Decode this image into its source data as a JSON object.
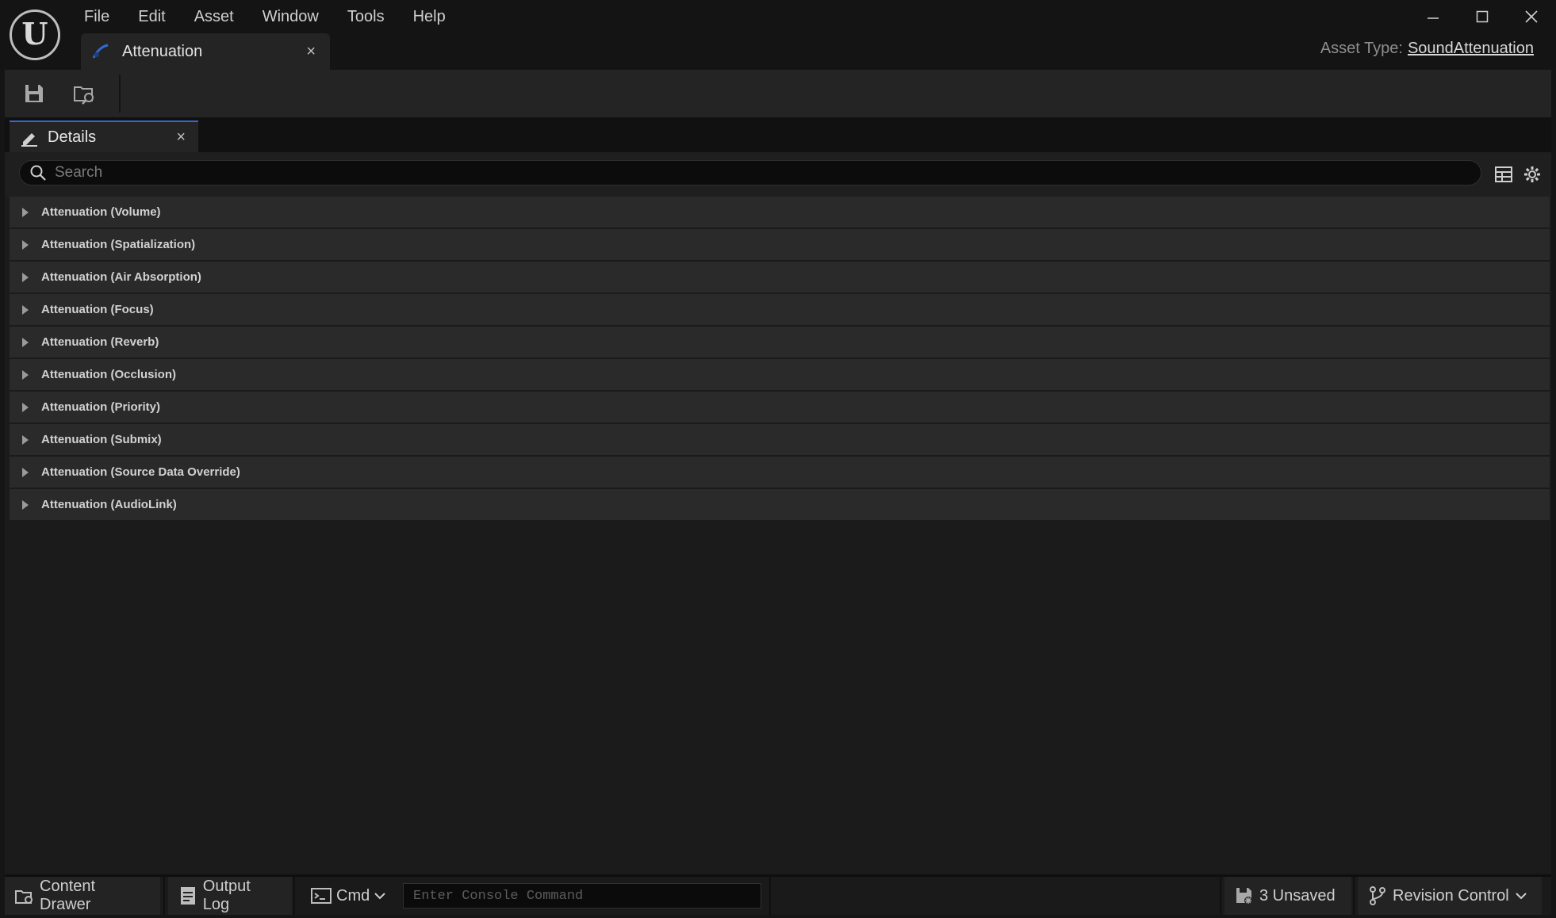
{
  "menu": [
    "File",
    "Edit",
    "Asset",
    "Window",
    "Tools",
    "Help"
  ],
  "window_controls": {
    "minimize": "–",
    "maximize": "☐",
    "close": "✕"
  },
  "asset_tab": {
    "label": "Attenuation",
    "close": "×",
    "icon": "sound-attenuation-icon"
  },
  "asset_type": {
    "label": "Asset Type:",
    "value": "SoundAttenuation"
  },
  "toolbar": {
    "save_icon": "save-icon",
    "browse_icon": "browse-to-asset-icon"
  },
  "details": {
    "tab_label": "Details",
    "close": "×",
    "search_placeholder": "Search",
    "categories": [
      "Attenuation (Volume)",
      "Attenuation (Spatialization)",
      "Attenuation (Air Absorption)",
      "Attenuation (Focus)",
      "Attenuation (Reverb)",
      "Attenuation (Occlusion)",
      "Attenuation (Priority)",
      "Attenuation (Submix)",
      "Attenuation (Source Data Override)",
      "Attenuation (AudioLink)"
    ]
  },
  "statusbar": {
    "content_drawer": "Content Drawer",
    "output_log": "Output Log",
    "cmd": "Cmd",
    "console_placeholder": "Enter Console Command",
    "unsaved": "3 Unsaved",
    "revision_control": "Revision Control"
  },
  "colors": {
    "accent": "#2f6bd3",
    "background": "#151515",
    "panel": "#242424",
    "row": "#2a2a2a"
  }
}
